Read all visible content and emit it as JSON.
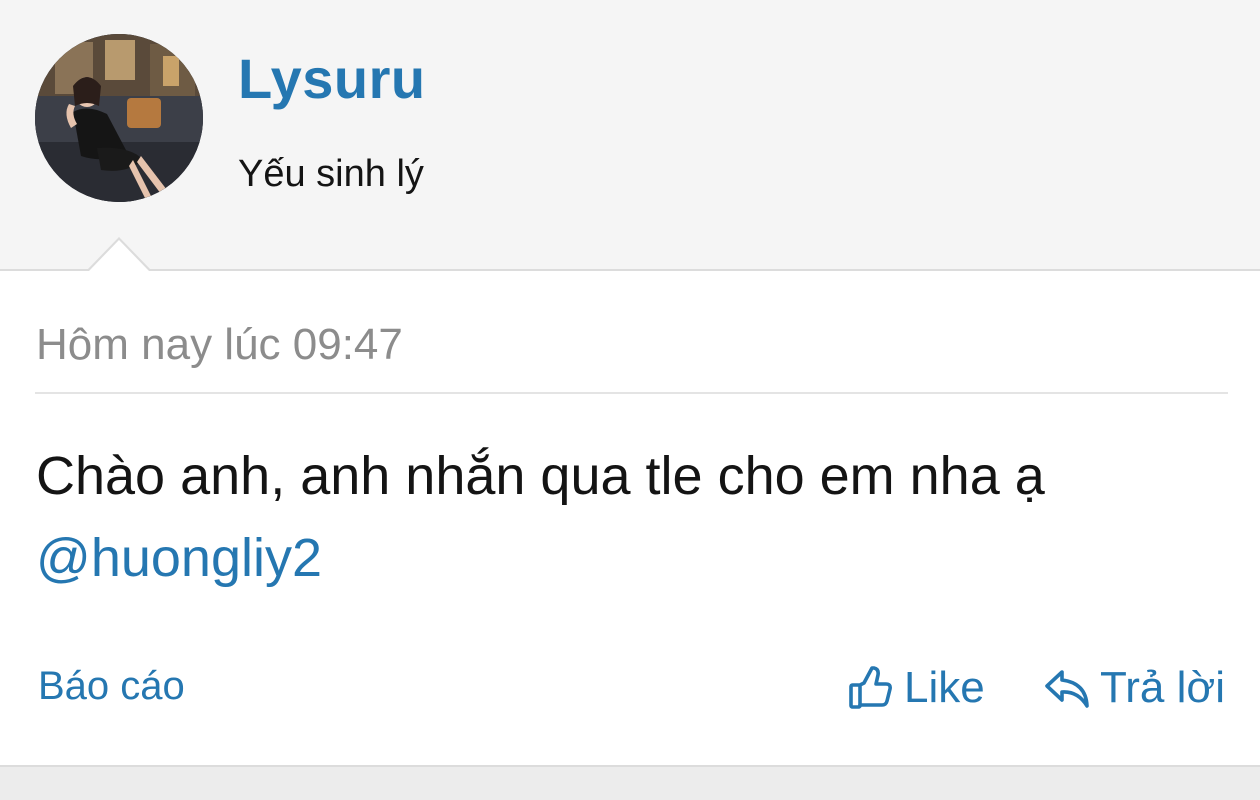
{
  "user": {
    "name": "Lysuru",
    "title": "Yếu sinh lý"
  },
  "post": {
    "time": "Hôm nay lúc 09:47",
    "message": "Chào anh, anh nhắn qua tle cho em nha ạ",
    "mention": "@huongliy2"
  },
  "actions": {
    "report_label": "Báo cáo",
    "like_label": "Like",
    "reply_label": "Trả lời"
  },
  "icons": {
    "like": "thumbs-up-icon",
    "reply": "reply-icon"
  },
  "colors": {
    "accent": "#2577b1",
    "text": "#141414",
    "muted": "#8c8c8c",
    "background": "#f5f5f5",
    "card": "#ffffff"
  }
}
